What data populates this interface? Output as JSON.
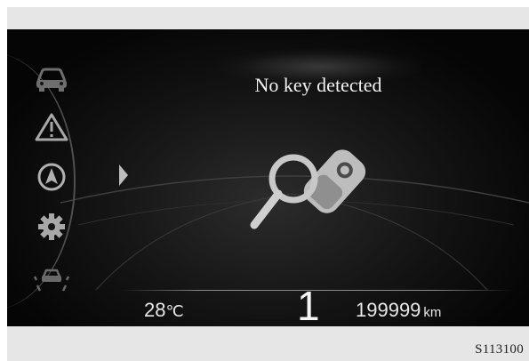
{
  "cluster": {
    "message": "No key detected",
    "temperature": {
      "value": "28",
      "unit": "℃"
    },
    "gear": "1",
    "odometer": {
      "value": "199999",
      "unit": "km"
    },
    "sidebar_icons": [
      "car-icon",
      "warning-triangle-icon",
      "navigation-icon",
      "settings-gear-icon",
      "lane-assist-icon"
    ],
    "center_icon": "no-key-detected-icon"
  },
  "figure": {
    "reference_code": "S113100"
  },
  "colors": {
    "screen_background": "#0a0a0a",
    "icon_gray": "#b0b0b0",
    "text": "#f2f2f2"
  }
}
